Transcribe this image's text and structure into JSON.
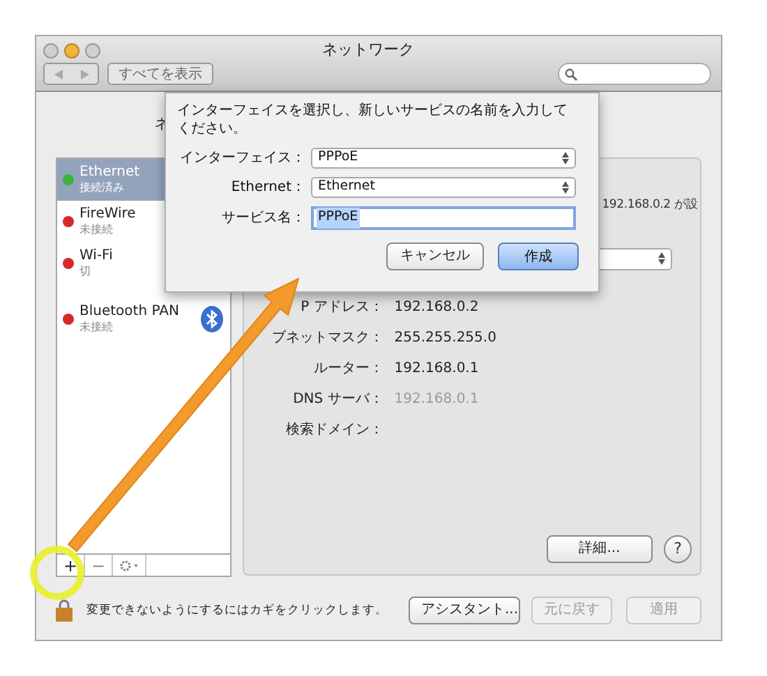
{
  "window": {
    "title": "ネットワーク"
  },
  "toolbar": {
    "show_all": "すべてを表示"
  },
  "location_label": "ネ",
  "services": [
    {
      "name": "Ethernet",
      "status": "接続済み",
      "color": "#3cb43c",
      "selected": true
    },
    {
      "name": "FireWire",
      "status": "未接続",
      "color": "#d62a2a",
      "selected": false
    },
    {
      "name": "Wi-Fi",
      "status": "切",
      "color": "#d62a2a",
      "selected": false
    },
    {
      "name": "Bluetooth PAN",
      "status": "未接続",
      "color": "#d62a2a",
      "selected": false,
      "kind": "bluetooth"
    }
  ],
  "list_buttons": [
    "+",
    "−"
  ],
  "detail": {
    "status_partial": "192.168.0.2 が設",
    "fields": [
      {
        "label": "P アドレス：",
        "value": "192.168.0.2"
      },
      {
        "label": "ブネットマスク：",
        "value": "255.255.255.0"
      },
      {
        "label": "ルーター：",
        "value": "192.168.0.1"
      },
      {
        "label": "DNS サーバ：",
        "value": "192.168.0.1",
        "dim": true
      },
      {
        "label": "検索ドメイン："
      }
    ],
    "advanced": "詳細...",
    "help": "?"
  },
  "footer": {
    "lock_text": "変更できないようにするにはカギをクリックします。",
    "assistant": {
      "label": "アシスタント...",
      "disabled": false
    },
    "revert": {
      "label": "元に戻す",
      "disabled": true
    },
    "apply": {
      "label": "適用",
      "disabled": true
    }
  },
  "sheet": {
    "message": "インターフェイスを選択し、新しいサービスの名前を入力してください。",
    "rows": [
      {
        "label": "インターフェイス：",
        "value": "PPPoE",
        "kind": "select"
      },
      {
        "label": "Ethernet：",
        "value": "Ethernet",
        "kind": "select"
      },
      {
        "label": "サービス名：",
        "value": "PPPoE",
        "kind": "text"
      }
    ],
    "cancel": "キャンセル",
    "create": "作成"
  }
}
